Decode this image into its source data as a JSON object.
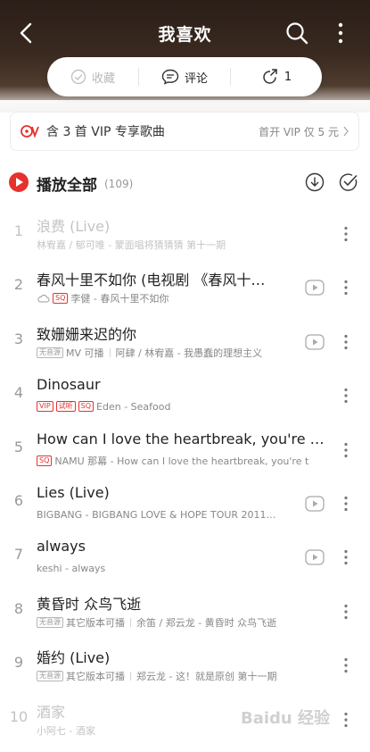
{
  "header": {
    "title": "我喜欢",
    "back_icon": "chevron-left-icon",
    "search_icon": "search-icon",
    "more_icon": "more-vertical-icon",
    "background": "#2a1e18"
  },
  "actions": {
    "collect_label": "收藏",
    "comment_label": "评论",
    "share_count": "1"
  },
  "vip_banner": {
    "text": "含 3 首 VIP 专享歌曲",
    "promo": "首开 VIP 仅 5 元"
  },
  "play_all": {
    "label": "播放全部",
    "count": "(109)"
  },
  "songs": [
    {
      "index": "1",
      "title": "浪费 (Live)",
      "tags": [],
      "meta": "林宥嘉 / 郁可唯 - 蒙面唱将猜猜猜 第十一期",
      "mv": false,
      "disabled": true
    },
    {
      "index": "2",
      "title": "春风十里不如你 (电视剧 《春风十…",
      "tags": [
        "cloud",
        "SQ"
      ],
      "meta": "李健 - 春风十里不如你",
      "mv": true
    },
    {
      "index": "3",
      "title": "致姗姗来迟的你",
      "tags": [
        "无音源"
      ],
      "meta_prefix": "MV 可播",
      "meta": "阿肆 / 林宥嘉 - 我愚蠢的理想主义",
      "mv": true
    },
    {
      "index": "4",
      "title": "Dinosaur",
      "tags": [
        "VIP",
        "试听",
        "SQ"
      ],
      "meta": "Eden - Seafood",
      "mv": false
    },
    {
      "index": "5",
      "title": "How can I love the heartbreak, you're the…",
      "tags": [
        "SQ"
      ],
      "meta": "NAMU 那幕 - How can I love the heartbreak, you're t",
      "mv": false
    },
    {
      "index": "6",
      "title": "Lies (Live)",
      "tags": [],
      "meta": "BIGBANG - BIGBANG LOVE & HOPE TOUR 2011…",
      "mv": true
    },
    {
      "index": "7",
      "title": "always",
      "tags": [],
      "meta": "keshi - always",
      "mv": true
    },
    {
      "index": "8",
      "title": "黄昏时 众鸟飞逝",
      "tags": [
        "无音源"
      ],
      "meta_prefix": "其它版本可播",
      "meta": "余笛 / 郑云龙 - 黄昏时 众鸟飞逝",
      "mv": false
    },
    {
      "index": "9",
      "title": "婚约 (Live)",
      "tags": [
        "无音源"
      ],
      "meta_prefix": "其它版本可播",
      "meta": "郑云龙 - 这！就是原创 第十一期",
      "mv": false
    },
    {
      "index": "10",
      "title": "酒家",
      "tags": [],
      "meta": "小阿七 - 酒家",
      "mv": false,
      "disabled": true
    }
  ],
  "watermark": "Baidu 经验",
  "colors": {
    "accent_red": "#e5322d",
    "text_primary": "#222222",
    "text_secondary": "#888888",
    "disabled_text": "#c4c4c4"
  }
}
